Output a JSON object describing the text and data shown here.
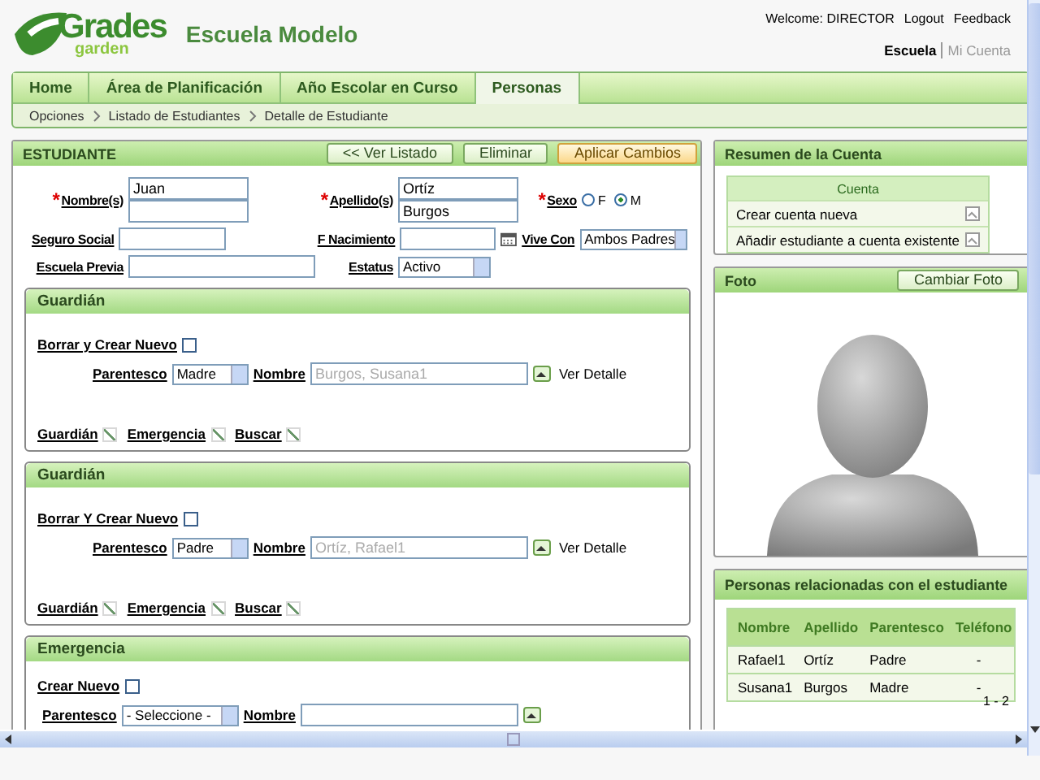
{
  "header": {
    "logo": "Grades",
    "logo_sub": "garden",
    "school": "Escuela Modelo",
    "welcome": "Welcome: DIRECTOR",
    "links": [
      "Logout",
      "Feedback"
    ],
    "context": [
      {
        "label": "Escuela",
        "selected": true
      },
      {
        "label": "Mi Cuenta",
        "selected": false
      }
    ]
  },
  "tabs": [
    {
      "label": "Home",
      "selected": false
    },
    {
      "label": "Área de Planificación",
      "selected": false
    },
    {
      "label": "Año Escolar en Curso",
      "selected": false
    },
    {
      "label": "Personas",
      "selected": true
    }
  ],
  "breadcrumb": [
    "Opciones",
    "Listado de Estudiantes",
    "Detalle de Estudiante"
  ],
  "student": {
    "title": "ESTUDIANTE",
    "buttons": [
      {
        "label": "<< Ver Listado",
        "kind": "normal"
      },
      {
        "label": "Eliminar",
        "kind": "normal"
      },
      {
        "label": "Aplicar Cambios",
        "kind": "primary"
      }
    ],
    "nombre": {
      "mark": "*",
      "label": "Nombre(s)",
      "values": [
        "Juan"
      ]
    },
    "apellido": {
      "mark": "*",
      "label": "Apellido(s)",
      "values": [
        "Ortíz",
        "Burgos"
      ]
    },
    "sexo": {
      "mark": "*",
      "label": "Sexo",
      "options": [
        {
          "label": "F",
          "selected": false
        },
        {
          "label": "M",
          "selected": true
        }
      ]
    },
    "seguro_social": {
      "label": "Seguro Social"
    },
    "nacimiento": {
      "label": "F Nacimiento"
    },
    "vive_con": {
      "label": "Vive Con",
      "value": "Ambos Padres"
    },
    "escuela_previa": {
      "label": "Escuela Previa"
    },
    "estatus": {
      "label": "Estatus",
      "value": "Activo"
    },
    "guardians": [
      {
        "title": "Guardián",
        "reset_label": "Borrar y Crear Nuevo",
        "reset_checked": false,
        "parentesco_label": "Parentesco",
        "parentesco": "Madre",
        "nombre_label": "Nombre",
        "nombre": "Burgos, Susana1",
        "detail": "Ver Detalle",
        "roles": [
          {
            "label": "Guardián",
            "checked": true,
            "disabled": true
          },
          {
            "label": "Emergencia",
            "checked": true,
            "disabled": true
          },
          {
            "label": "Buscar",
            "checked": true,
            "disabled": true
          }
        ]
      },
      {
        "title": "Guardián",
        "reset_label": "Borrar Y Crear Nuevo",
        "reset_checked": false,
        "parentesco_label": "Parentesco",
        "parentesco": "Padre",
        "nombre_label": "Nombre",
        "nombre": "Ortíz, Rafael1",
        "detail": "Ver Detalle",
        "roles": [
          {
            "label": "Guardián",
            "checked": true,
            "disabled": true
          },
          {
            "label": "Emergencia",
            "checked": true,
            "disabled": true
          },
          {
            "label": "Buscar",
            "checked": true,
            "disabled": true
          }
        ]
      }
    ],
    "emergency": {
      "title": "Emergencia",
      "new_label": "Crear Nuevo",
      "new_checked": false,
      "parentesco_label": "Parentesco",
      "parentesco": "- Seleccione -",
      "nombre_label": "Nombre"
    }
  },
  "account": {
    "title": "Resumen de la Cuenta",
    "header": "Cuenta",
    "items": [
      "Crear cuenta nueva",
      "Añadir estudiante a cuenta existente"
    ]
  },
  "photo": {
    "title": "Foto",
    "button": "Cambiar Foto"
  },
  "related": {
    "title": "Personas relacionadas con el estudiante",
    "columns": [
      "Nombre",
      "Apellido",
      "Parentesco",
      "Teléfono"
    ],
    "rows": [
      [
        "Rafael1",
        "Ortíz",
        "Padre",
        "-"
      ],
      [
        "Susana1",
        "Burgos",
        "Madre",
        "-"
      ]
    ],
    "pager": "1 - 2"
  }
}
